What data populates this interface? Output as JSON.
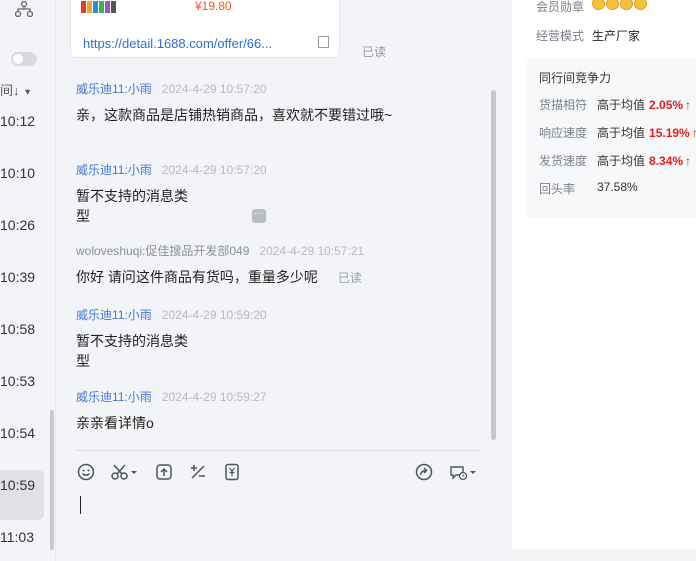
{
  "left_column": {
    "sort_label": "间↓",
    "sort_caret": "▾",
    "times": [
      "10:12",
      "10:10",
      "10:26",
      "10:39",
      "10:58",
      "10:53",
      "10:54",
      "10:59",
      "11:03"
    ]
  },
  "product_card": {
    "price": "¥19.80",
    "link": "https://detail.1688.com/offer/66...",
    "read_status": "已读"
  },
  "messages": [
    {
      "sender": "威乐迪11:小雨",
      "time": "2024-4-29 10:57:20",
      "text": "亲，这款商品是店铺热销商品，喜欢就不要错过哦~",
      "role": "seller"
    },
    {
      "sender": "威乐迪11:小雨",
      "time": "2024-4-29 10:57:20",
      "text": "暂不支持的消息类型",
      "role": "seller"
    },
    {
      "sender": "woloveshuqi:促佳搜品开发部049",
      "time": "2024-4-29 10:57:21",
      "text": "你好 请问这件商品有货吗，重量多少呢",
      "role": "buyer",
      "read": "已读"
    },
    {
      "sender": "威乐迪11:小雨",
      "time": "2024-4-29 10:59:20",
      "text": "暂不支持的消息类型",
      "role": "seller"
    },
    {
      "sender": "威乐迪11:小雨",
      "time": "2024-4-29 10:59:27",
      "text": "亲亲看详情o",
      "role": "seller"
    }
  ],
  "toolbar": {
    "icons": [
      "emoji-icon",
      "scissors-icon",
      "upload-icon",
      "fraction-icon",
      "coupon-icon",
      "share-icon",
      "history-icon"
    ]
  },
  "right_panel": {
    "member_label": "会员勋章",
    "business_label": "经营模式",
    "business_value": "生产厂家",
    "competition_title": "同行间竞争力",
    "rows": [
      {
        "label": "货描相符",
        "text": "高于均值",
        "pct": "2.05%",
        "arrow": "↑"
      },
      {
        "label": "响应速度",
        "text": "高于均值",
        "pct": "15.19%",
        "arrow": "↑"
      },
      {
        "label": "发货速度",
        "text": "高于均值",
        "pct": "8.34%",
        "arrow": "↑"
      }
    ],
    "repeat_label": "回头率",
    "repeat_value": "37.58%"
  },
  "colors": {
    "accent_link": "#2f6fd6",
    "sender_seller": "#3f79d6",
    "positive_red": "#e02020",
    "price_orange": "#f25a1f"
  }
}
